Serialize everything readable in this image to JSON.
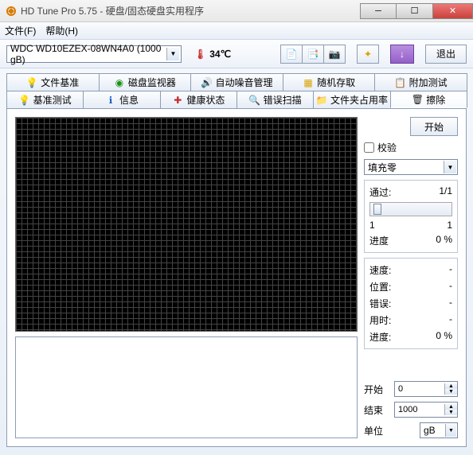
{
  "window": {
    "title": "HD Tune Pro 5.75 - 硬盘/固态硬盘实用程序"
  },
  "menu": {
    "file": "文件(F)",
    "help": "帮助(H)"
  },
  "toolbar": {
    "drive": "WDC WD10EZEX-08WN4A0 (1000 gB)",
    "temp": "34℃",
    "exit": "退出"
  },
  "tabs_row1": [
    {
      "icon": "bulb",
      "label": "文件基准"
    },
    {
      "icon": "disk",
      "label": "磁盘监视器"
    },
    {
      "icon": "speaker",
      "label": "自动噪音管理"
    },
    {
      "icon": "doc",
      "label": "随机存取"
    },
    {
      "icon": "clip",
      "label": "附加测试"
    }
  ],
  "tabs_row2": [
    {
      "icon": "bulb2",
      "label": "基准测试"
    },
    {
      "icon": "info",
      "label": "信息"
    },
    {
      "icon": "plus",
      "label": "健康状态"
    },
    {
      "icon": "mag",
      "label": "错误扫描"
    },
    {
      "icon": "folder",
      "label": "文件夹占用率"
    },
    {
      "icon": "trash",
      "label": "擦除",
      "active": true
    }
  ],
  "panel": {
    "start": "开始",
    "verify": "校验",
    "fill_mode": "填充零",
    "pass_label": "通过:",
    "pass_value": "1/1",
    "range_min": "1",
    "range_max": "1",
    "progress_label": "进度",
    "progress_value": "0 %",
    "speed_label": "速度:",
    "speed_value": "-",
    "position_label": "位置:",
    "position_value": "-",
    "errors_label": "错误:",
    "errors_value": "-",
    "elapsed_label": "用时:",
    "elapsed_value": "-",
    "progress2_label": "进度:",
    "progress2_value": "0 %",
    "start_label": "开始",
    "start_value": "0",
    "end_label": "结束",
    "end_value": "1000",
    "unit_label": "单位",
    "unit_value": "gB"
  }
}
